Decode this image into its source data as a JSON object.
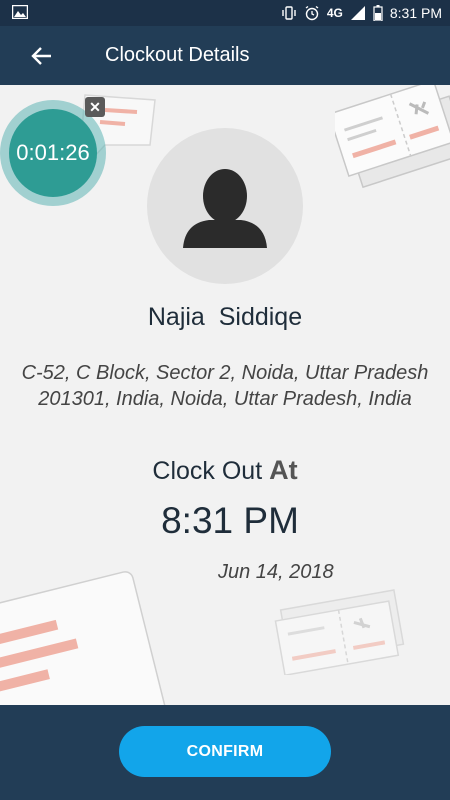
{
  "statusbar": {
    "network": "4G",
    "time": "8:31 PM"
  },
  "appbar": {
    "title": "Clockout Details"
  },
  "timer": {
    "value": "0:01:26"
  },
  "user": {
    "name": "Najia  Siddiqe",
    "address_line1": "C-52, C Block, Sector 2, Noida, Uttar Pradesh",
    "address_line2": "201301, India, Noida, Uttar Pradesh, India"
  },
  "clockout": {
    "label": "Clock Out",
    "label_at": "At",
    "time": "8:31 PM",
    "date": "Jun 14, 2018"
  },
  "actions": {
    "confirm_label": "CONFIRM"
  },
  "colors": {
    "appbar": "#223d56",
    "statusbar": "#1c3148",
    "confirm": "#12a5ea",
    "timer": "#2e9c94"
  }
}
